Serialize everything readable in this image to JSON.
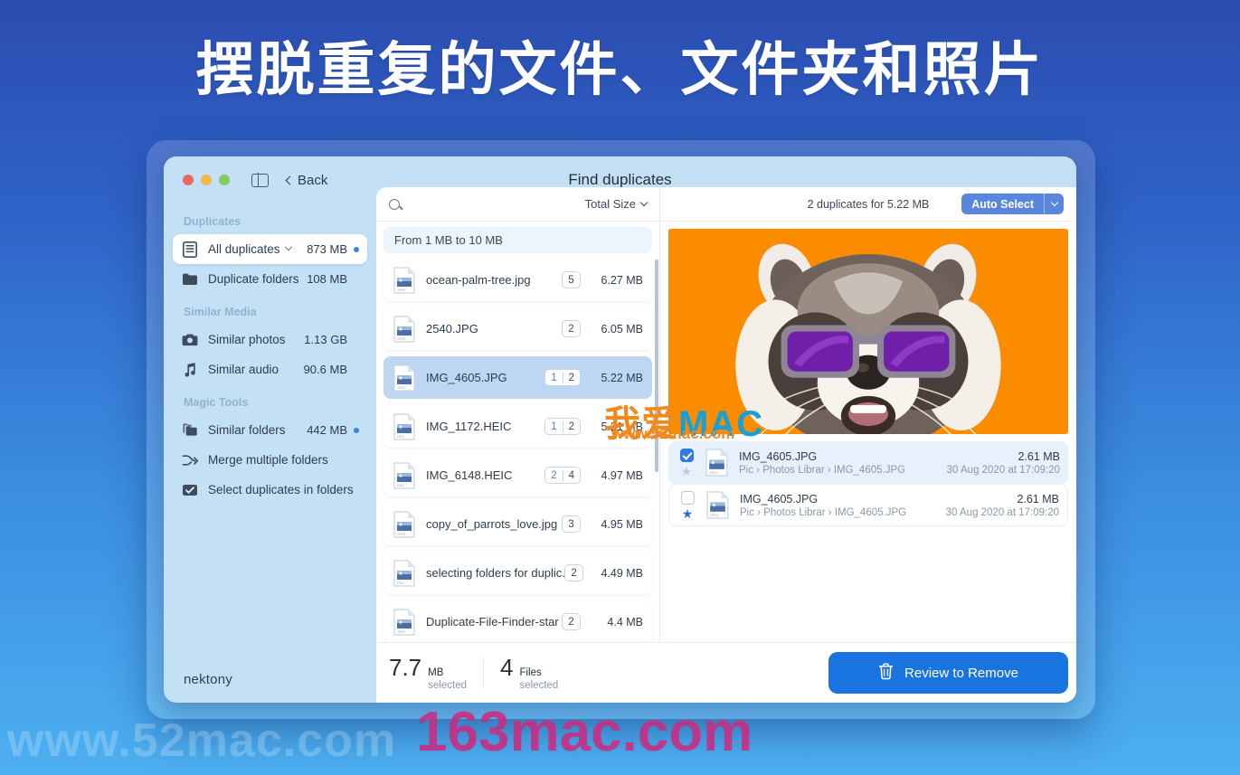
{
  "headline": "摆脱重复的文件、文件夹和照片",
  "brand": {
    "logo": "nektony"
  },
  "titlebar": {
    "title": "Find duplicates",
    "back_label": "Back",
    "sidebar_toggle_icon": "sidebar-toggle-icon",
    "traffic_lights": [
      "close",
      "minimize",
      "maximize"
    ]
  },
  "sidebar": {
    "groups": [
      {
        "label": "Duplicates",
        "items": [
          {
            "label": "All duplicates",
            "size": "873 MB",
            "icon": "list-icon",
            "active": true,
            "caret": true,
            "bullet": true
          },
          {
            "label": "Duplicate folders",
            "size": "108 MB",
            "icon": "folder-icon",
            "active": false,
            "caret": false,
            "bullet": false
          }
        ]
      },
      {
        "label": "Similar Media",
        "items": [
          {
            "label": "Similar photos",
            "size": "1.13 GB",
            "icon": "camera-icon",
            "active": false,
            "caret": false,
            "bullet": false
          },
          {
            "label": "Similar audio",
            "size": "90.6 MB",
            "icon": "music-note-icon",
            "active": false,
            "caret": false,
            "bullet": false
          }
        ]
      },
      {
        "label": "Magic Tools",
        "items": [
          {
            "label": "Similar folders",
            "size": "442 MB",
            "icon": "similar-folders-icon",
            "active": false,
            "caret": false,
            "bullet": true
          },
          {
            "label": "Merge multiple folders",
            "size": "",
            "icon": "merge-icon",
            "active": false,
            "caret": false,
            "bullet": false
          },
          {
            "label": "Select duplicates in folders",
            "size": "",
            "icon": "checkbox-folder-icon",
            "active": false,
            "caret": false,
            "bullet": false
          }
        ]
      }
    ]
  },
  "file_list": {
    "search_placeholder": "",
    "search_icon": "search-icon",
    "sort_label": "Total Size",
    "range_header": "From 1 MB to 10 MB",
    "rows": [
      {
        "name": "ocean-palm-tree.jpg",
        "type": "JPEG",
        "count": "5",
        "count2": "",
        "size": "6.27 MB",
        "selected": false
      },
      {
        "name": "2540.JPG",
        "type": "JPEG",
        "count": "2",
        "count2": "",
        "size": "6.05 MB",
        "selected": false
      },
      {
        "name": "IMG_4605.JPG",
        "type": "JPEG",
        "count": "1",
        "count2": "2",
        "size": "5.22 MB",
        "selected": true
      },
      {
        "name": "IMG_1172.HEIC",
        "type": "HEIC",
        "count": "1",
        "count2": "2",
        "size": "5.21 MB",
        "selected": false
      },
      {
        "name": "IMG_6148.HEIC",
        "type": "HEIC",
        "count": "2",
        "count2": "4",
        "size": "4.97 MB",
        "selected": false
      },
      {
        "name": "copy_of_parrots_love.jpg",
        "type": "JPEG",
        "count": "3",
        "count2": "",
        "size": "4.95 MB",
        "selected": false
      },
      {
        "name": "selecting folders for duplic...",
        "type": "PNG",
        "count": "2",
        "count2": "",
        "size": "4.49 MB",
        "selected": false
      },
      {
        "name": "Duplicate-File-Finder-star",
        "type": "JPEG",
        "count": "2",
        "count2": "",
        "size": "4.4 MB",
        "selected": false
      }
    ]
  },
  "preview": {
    "summary": "2 duplicates for 5.22 MB",
    "auto_select_label": "Auto Select",
    "image_alt": "raccoon-with-sunglasses-photo",
    "duplicates": [
      {
        "name": "IMG_4605.JPG",
        "path": "Pic › Photos Librar › IMG_4605.JPG",
        "size": "2.61 MB",
        "date": "30 Aug 2020 at 17:09:20",
        "checked": true,
        "starred": false,
        "type": "JPEG"
      },
      {
        "name": "IMG_4605.JPG",
        "path": "Pic › Photos Librar › IMG_4605.JPG",
        "size": "2.61 MB",
        "date": "30 Aug 2020 at 17:09:20",
        "checked": false,
        "starred": true,
        "type": "JPEG"
      }
    ]
  },
  "bottom_bar": {
    "size_value": "7.7",
    "size_unit": "MB",
    "size_sub": "selected",
    "files_value": "4",
    "files_unit": "Files",
    "files_sub": "selected",
    "review_label": "Review to Remove",
    "review_icon": "trash-icon"
  },
  "watermarks": {
    "site_52mac": "www.52mac.com",
    "site_163mac": "163mac.com",
    "mac_cn": "我爱",
    "mac_en": "MAC",
    "mac_sub": "www.52mac.com"
  },
  "colors": {
    "accent_blue": "#1a74e0",
    "auto_select_blue": "#5b86dd",
    "image_bg_orange": "#FB8C00",
    "selected_row": "#bdd6f2"
  }
}
